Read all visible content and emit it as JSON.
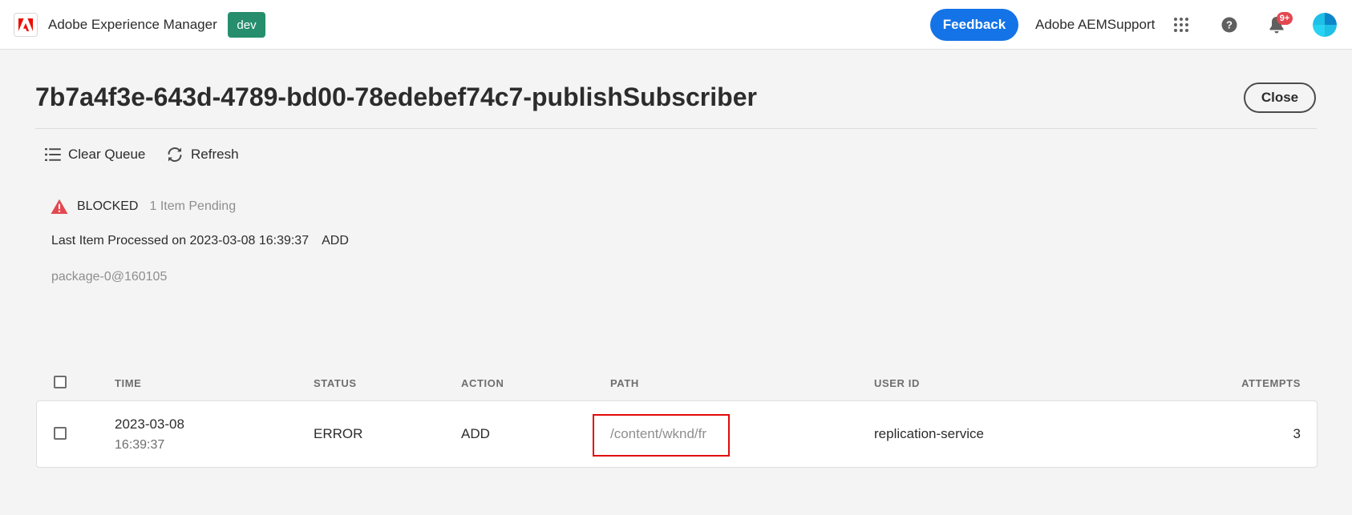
{
  "header": {
    "app_title": "Adobe Experience Manager",
    "env_badge": "dev",
    "feedback_label": "Feedback",
    "org_name": "Adobe AEMSupport",
    "notification_count": "9+",
    "icons": [
      "adobe-logo-icon",
      "apps-grid-icon",
      "help-icon",
      "bell-icon",
      "avatar"
    ]
  },
  "page": {
    "title": "7b7a4f3e-643d-4789-bd00-78edebef74c7-publishSubscriber",
    "close_label": "Close"
  },
  "actions": {
    "clear_queue": "Clear Queue",
    "refresh": "Refresh"
  },
  "status": {
    "state": "BLOCKED",
    "pending": "1 Item Pending",
    "last_processed": "Last Item Processed on 2023-03-08 16:39:37",
    "last_action": "ADD",
    "package": "package-0@160105"
  },
  "table": {
    "columns": [
      "TIME",
      "STATUS",
      "ACTION",
      "PATH",
      "USER ID",
      "ATTEMPTS"
    ],
    "rows": [
      {
        "date": "2023-03-08",
        "time": "16:39:37",
        "status": "ERROR",
        "action": "ADD",
        "path": "/content/wknd/fr",
        "user_id": "replication-service",
        "attempts": "3"
      }
    ]
  },
  "colors": {
    "accent": "#1473e6",
    "env_badge": "#268e6c",
    "warning": "#e34850",
    "highlight": "#e10a0a"
  }
}
